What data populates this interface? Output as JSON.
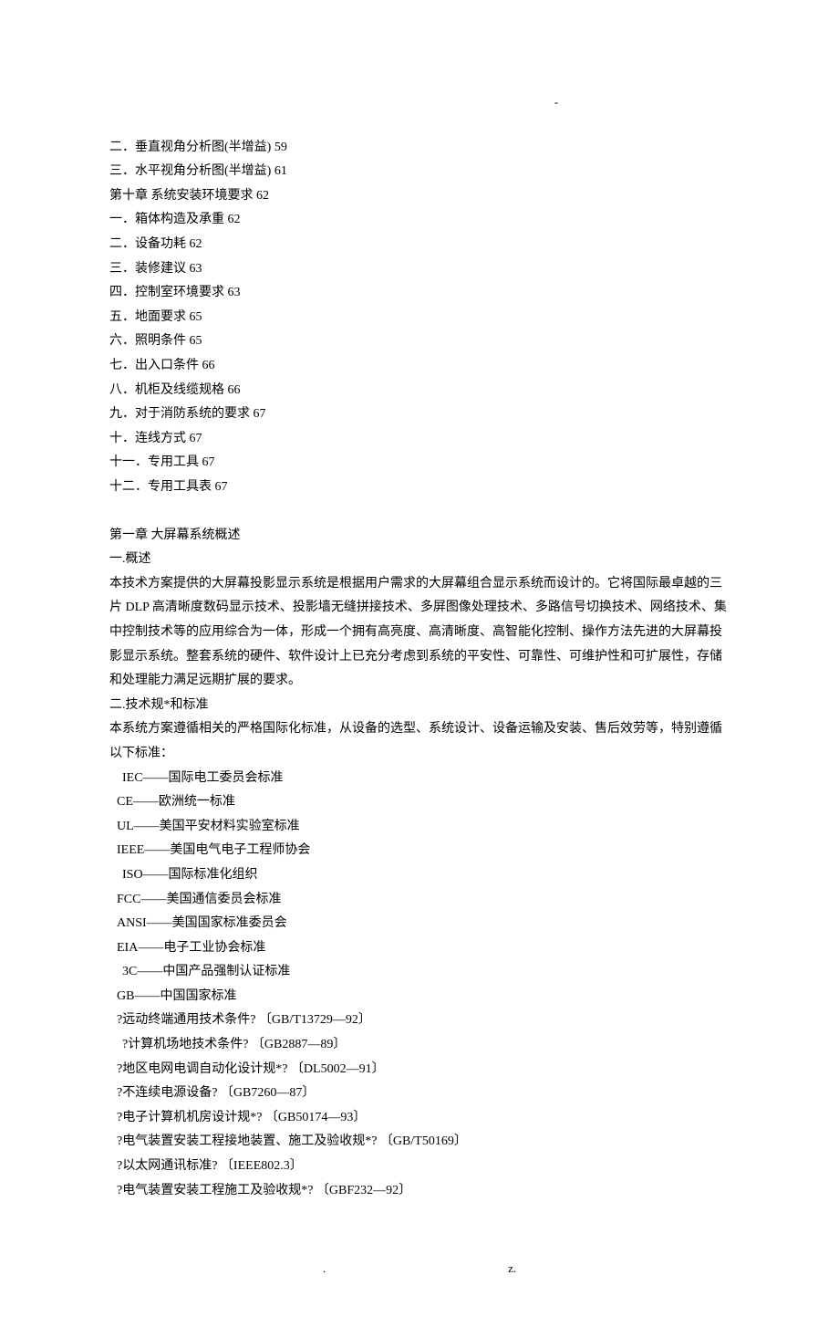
{
  "dash_top": "-",
  "toc": [
    "二．垂直视角分析图(半增益) 59",
    "三．水平视角分析图(半增益) 61",
    "第十章 系统安装环境要求 62",
    "一．箱体构造及承重 62",
    "二．设备功耗 62",
    "三．装修建议 63",
    "四．控制室环境要求 63",
    "五．地面要求 65",
    "六．照明条件 65",
    "七．出入口条件 66",
    "八．机柜及线缆规格 66",
    "九．对于消防系统的要求 67",
    "十．连线方式 67",
    "十一．专用工具 67",
    "十二．专用工具表 67"
  ],
  "chapter_heading": "第一章 大屏幕系统概述",
  "sec1_title": "一.概述",
  "sec1_body": "本技术方案提供的大屏幕投影显示系统是根据用户需求的大屏幕组合显示系统而设计的。它将国际最卓越的三片 DLP 高清晰度数码显示技术、投影墙无缝拼接技术、多屏图像处理技术、多路信号切换技术、网络技术、集中控制技术等的应用综合为一体，形成一个拥有高亮度、高清晰度、高智能化控制、操作方法先进的大屏幕投影显示系统。整套系统的硬件、软件设计上已充分考虑到系统的平安性、可靠性、可维护性和可扩展性，存储和处理能力满足远期扩展的要求。",
  "sec2_title": "二.技术规*和标准",
  "sec2_intro": "本系统方案遵循相关的严格国际化标准，从设备的选型、系统设计、设备运输及安装、售后效劳等，特别遵循以下标准：",
  "standards": [
    {
      "indent": 1,
      "text": "IEC——国际电工委员会标准"
    },
    {
      "indent": 0,
      "text": " CE——欧洲统一标准"
    },
    {
      "indent": 0,
      "text": " UL——美国平安材料实验室标准"
    },
    {
      "indent": 0,
      "text": " IEEE——美国电气电子工程师协会"
    },
    {
      "indent": 1,
      "text": "ISO——国际标准化组织"
    },
    {
      "indent": 0,
      "text": " FCC——美国通信委员会标准"
    },
    {
      "indent": 0,
      "text": " ANSI——美国国家标准委员会"
    },
    {
      "indent": 0,
      "text": " EIA——电子工业协会标准"
    },
    {
      "indent": 1,
      "text": "3C——中国产品强制认证标准"
    },
    {
      "indent": 0,
      "text": " GB——中国国家标准"
    },
    {
      "indent": 0,
      "text": " ?远动终端通用技术条件? 〔GB/T13729—92〕"
    },
    {
      "indent": 1,
      "text": "?计算机场地技术条件? 〔GB2887—89〕"
    },
    {
      "indent": 0,
      "text": " ?地区电网电调自动化设计规*? 〔DL5002—91〕"
    },
    {
      "indent": 0,
      "text": " ?不连续电源设备?      〔GB7260—87〕"
    },
    {
      "indent": 0,
      "text": " ?电子计算机机房设计规*? 〔GB50174—93〕"
    },
    {
      "indent": 0,
      "text": " ?电气装置安装工程接地装置、施工及验收规*?     〔GB/T50169〕"
    },
    {
      "indent": 0,
      "text": " ?以太网通讯标准? 〔IEEE802.3〕"
    },
    {
      "indent": 0,
      "text": " ?电气装置安装工程施工及验收规*?      〔GBF232—92〕"
    }
  ],
  "footer_left": ".",
  "footer_right": "z."
}
